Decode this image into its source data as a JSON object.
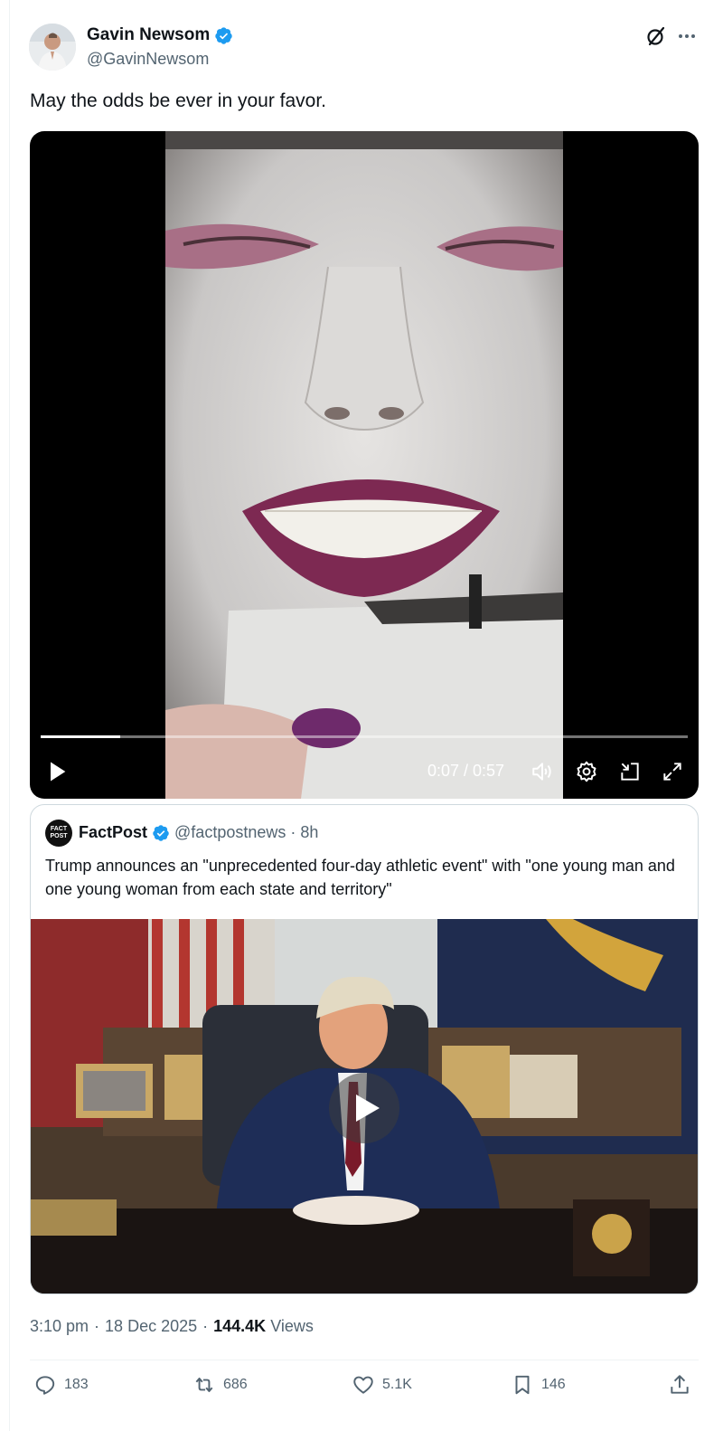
{
  "author": {
    "display_name": "Gavin Newsom",
    "handle": "@GavinNewsom",
    "verified": true
  },
  "tweet": {
    "text": "May the odds be ever in your favor."
  },
  "video": {
    "time": "0:07 / 0:57",
    "progress": 0.123
  },
  "quoted": {
    "display_name": "FactPost",
    "avatar_text": "FACT POST",
    "handle": "@factpostnews",
    "separator": "·",
    "time": "8h",
    "text": "Trump announces an \"unprecedented four-day athletic event\" with \"one young man and one young woman from each state and territory\""
  },
  "meta": {
    "time": "3:10 pm",
    "sep1": "·",
    "date": "18 Dec 2025",
    "sep2": "·",
    "views_count": "144.4K",
    "views_label": "Views"
  },
  "actions": {
    "replies": "183",
    "reposts": "686",
    "likes": "5.1K",
    "bookmarks": "146"
  },
  "colors": {
    "verified": "#1d9bf0",
    "secondary_text": "#536471",
    "border": "#cfd9de"
  }
}
